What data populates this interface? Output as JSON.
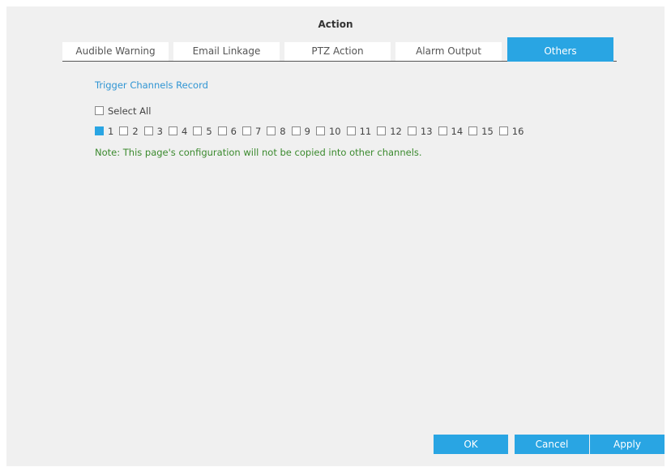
{
  "dialog": {
    "title": "Action"
  },
  "tabs": [
    {
      "label": "Audible Warning",
      "active": false
    },
    {
      "label": "Email Linkage",
      "active": false
    },
    {
      "label": "PTZ Action",
      "active": false
    },
    {
      "label": "Alarm Output",
      "active": false
    },
    {
      "label": "Others",
      "active": true
    }
  ],
  "section": {
    "title": "Trigger Channels Record"
  },
  "select_all": {
    "label": "Select All",
    "checked": false
  },
  "channels": [
    {
      "label": "1",
      "checked": true
    },
    {
      "label": "2",
      "checked": false
    },
    {
      "label": "3",
      "checked": false
    },
    {
      "label": "4",
      "checked": false
    },
    {
      "label": "5",
      "checked": false
    },
    {
      "label": "6",
      "checked": false
    },
    {
      "label": "7",
      "checked": false
    },
    {
      "label": "8",
      "checked": false
    },
    {
      "label": "9",
      "checked": false
    },
    {
      "label": "10",
      "checked": false
    },
    {
      "label": "11",
      "checked": false
    },
    {
      "label": "12",
      "checked": false
    },
    {
      "label": "13",
      "checked": false
    },
    {
      "label": "14",
      "checked": false
    },
    {
      "label": "15",
      "checked": false
    },
    {
      "label": "16",
      "checked": false
    }
  ],
  "note": "Note: This page's configuration will not be copied into other channels.",
  "buttons": {
    "ok": "OK",
    "cancel": "Cancel",
    "apply": "Apply"
  },
  "colors": {
    "accent": "#29a5e3",
    "note": "#3b8a2e",
    "background": "#f0f0f0"
  }
}
